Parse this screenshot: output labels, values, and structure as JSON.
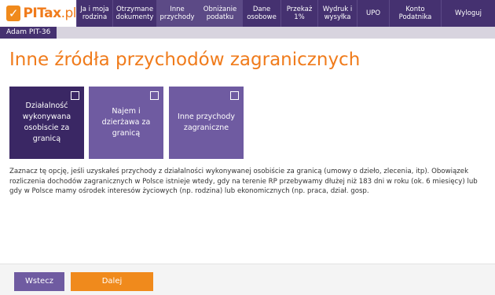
{
  "logo": {
    "mark": "✓",
    "text_main": "PITax",
    "text_suffix": ".pl"
  },
  "nav": [
    {
      "id": "ja-i-moja-rodzina",
      "label": "Ja i moja rodzina",
      "active": false
    },
    {
      "id": "otrzymane-dokumenty",
      "label": "Otrzymane dokumenty",
      "active": false
    },
    {
      "id": "inne-przychody",
      "label": "Inne przychody",
      "active": true
    },
    {
      "id": "obnizanie-podatku",
      "label": "Obniżanie podatku",
      "active": true
    },
    {
      "id": "dane-osobowe",
      "label": "Dane osobowe",
      "active": false
    },
    {
      "id": "przekaz-1",
      "label": "Przekaż 1%",
      "active": false
    },
    {
      "id": "wydruk-i-wysylka",
      "label": "Wydruk i wysyłka",
      "active": false
    },
    {
      "id": "upo",
      "label": "UPO",
      "active": false
    },
    {
      "id": "konto-podatnika",
      "label": "Konto Podatnika",
      "active": false
    },
    {
      "id": "wyloguj",
      "label": "Wyloguj",
      "active": false
    }
  ],
  "subtab": {
    "label": "Adam PIT-36"
  },
  "page": {
    "title": "Inne źródła przychodów zagranicznych"
  },
  "options": [
    {
      "id": "dzialalnosc",
      "label": "Działalność wykonywana osobiscie za granicą",
      "checked": false,
      "highlighted": true
    },
    {
      "id": "najem",
      "label": "Najem i dzierżawa za granicą",
      "checked": false,
      "highlighted": false
    },
    {
      "id": "inne",
      "label": "Inne przychody zagraniczne",
      "checked": false,
      "highlighted": false
    }
  ],
  "description": "Zaznacz tę opcję, jeśli uzyskałeś przychody z działalności wykonywanej osobiście za granicą (umowy o dzieło, zlecenia, itp). Obowiązek rozliczenia dochodów zagranicznych w Polsce istnieje wtedy, gdy na terenie RP przebywamy dłużej niż 183 dni w roku (ok. 6 miesięcy) lub gdy w Polsce mamy ośrodek interesów życiowych (np. rodzina) lub ekonomicznych (np. praca, dział. gosp.",
  "footer": {
    "back_label": "Wstecz",
    "next_label": "Dalej"
  },
  "colors": {
    "brand_orange": "#f07b1b",
    "nav_purple": "#453170",
    "tile_purple": "#6f5ba1",
    "tile_dark": "#3a2764"
  }
}
